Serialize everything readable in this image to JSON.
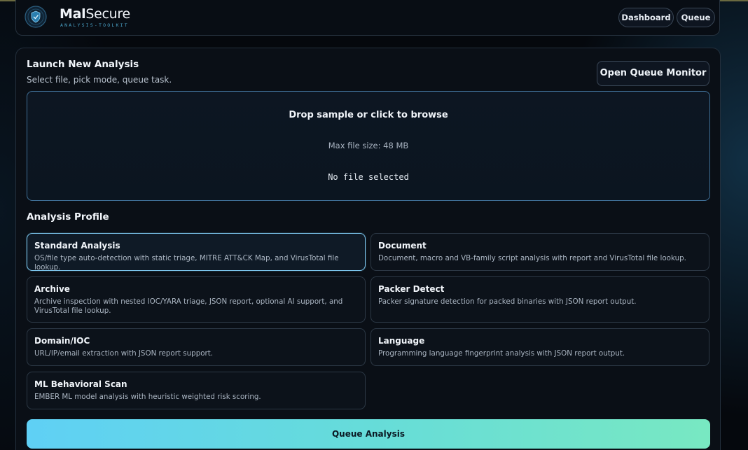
{
  "header": {
    "brand_bold": "Mal",
    "brand_rest": "Secure",
    "tagline": "ANALYSIS-TOOLKIT",
    "nav": {
      "dashboard": "Dashboard",
      "queue": "Queue"
    }
  },
  "launch": {
    "title": "Launch New Analysis",
    "subtitle": "Select file, pick mode, queue task.",
    "open_queue_label": "Open Queue Monitor"
  },
  "dropzone": {
    "title": "Drop sample or click to browse",
    "max_size": "Max file size: 48 MB",
    "file_status": "No file selected"
  },
  "profile": {
    "label": "Analysis Profile",
    "selected": "Standard Analysis",
    "options": [
      {
        "title": "Standard Analysis",
        "desc": "OS/file type auto-detection with static triage, MITRE ATT&CK Map, and VirusTotal file lookup."
      },
      {
        "title": "Document",
        "desc": "Document, macro and VB-family script analysis with report and VirusTotal file lookup."
      },
      {
        "title": "Archive",
        "desc": "Archive inspection with nested IOC/YARA triage, JSON report, optional AI support, and VirusTotal file lookup."
      },
      {
        "title": "Packer Detect",
        "desc": "Packer signature detection for packed binaries with JSON report output."
      },
      {
        "title": "Domain/IOC",
        "desc": "URL/IP/email extraction with JSON report support."
      },
      {
        "title": "Language",
        "desc": "Programming language fingerprint analysis with JSON report output."
      },
      {
        "title": "ML Behavioral Scan",
        "desc": "EMBER ML model analysis with heuristic weighted risk scoring."
      }
    ]
  },
  "submit": {
    "label": "Queue Analysis"
  },
  "colors": {
    "accent_start": "#5fd0f5",
    "accent_end": "#78e8c2",
    "selected_border": "#7cc6ee",
    "tagline": "#4aa3c8"
  },
  "icons": {
    "logo": "shield-globe-icon"
  }
}
